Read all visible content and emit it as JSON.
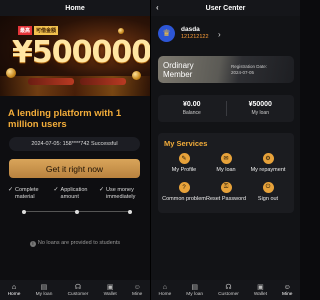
{
  "home": {
    "title": "Home",
    "banner": {
      "tag_red": "最高",
      "tag_gold": "可借金額",
      "amount": "¥500000"
    },
    "headline": "A lending platform with 1 million users",
    "notice": "2024-07-05: 158****742 Successful",
    "cta_label": "Get it right now",
    "features": [
      {
        "label": "Complete material"
      },
      {
        "label": "Application amount"
      },
      {
        "label": "Use money immediately"
      }
    ],
    "empty_text": "No loans are provided to students",
    "check_icon": "check-icon",
    "info_icon": "info-icon"
  },
  "user_center": {
    "title": "User Center",
    "back_icon": "chevron-left-icon",
    "user": {
      "name": "dasda",
      "phone": "121212122",
      "avatar_icon": "crown-icon"
    },
    "member": {
      "title": "Ordinary Member",
      "reg_label": "Registration Date:",
      "reg_date": "2024-07-05"
    },
    "balance": {
      "value": "¥0.00",
      "label": "Balance"
    },
    "my_loan": {
      "value": "¥50000",
      "label": "My loan"
    },
    "services_title": "My Services",
    "services": [
      {
        "label": "My Profile",
        "icon": "profile-icon"
      },
      {
        "label": "My loan",
        "icon": "loan-icon"
      },
      {
        "label": "My repayment",
        "icon": "repayment-icon"
      },
      {
        "label": "Common problem",
        "icon": "question-icon"
      },
      {
        "label": "Reset Password",
        "icon": "lock-icon"
      },
      {
        "label": "Sign out",
        "icon": "power-icon"
      }
    ]
  },
  "tabbar": [
    {
      "label": "Home",
      "icon": "home-icon"
    },
    {
      "label": "My loan",
      "icon": "loan-icon"
    },
    {
      "label": "Customer",
      "icon": "headset-icon"
    },
    {
      "label": "Wallet",
      "icon": "wallet-icon"
    },
    {
      "label": "Mine",
      "icon": "user-icon"
    }
  ],
  "colors": {
    "accent": "#f3ad3a",
    "phone": "#ff9f39",
    "button": "#d9a55a",
    "avatar": "#2d56d6"
  }
}
